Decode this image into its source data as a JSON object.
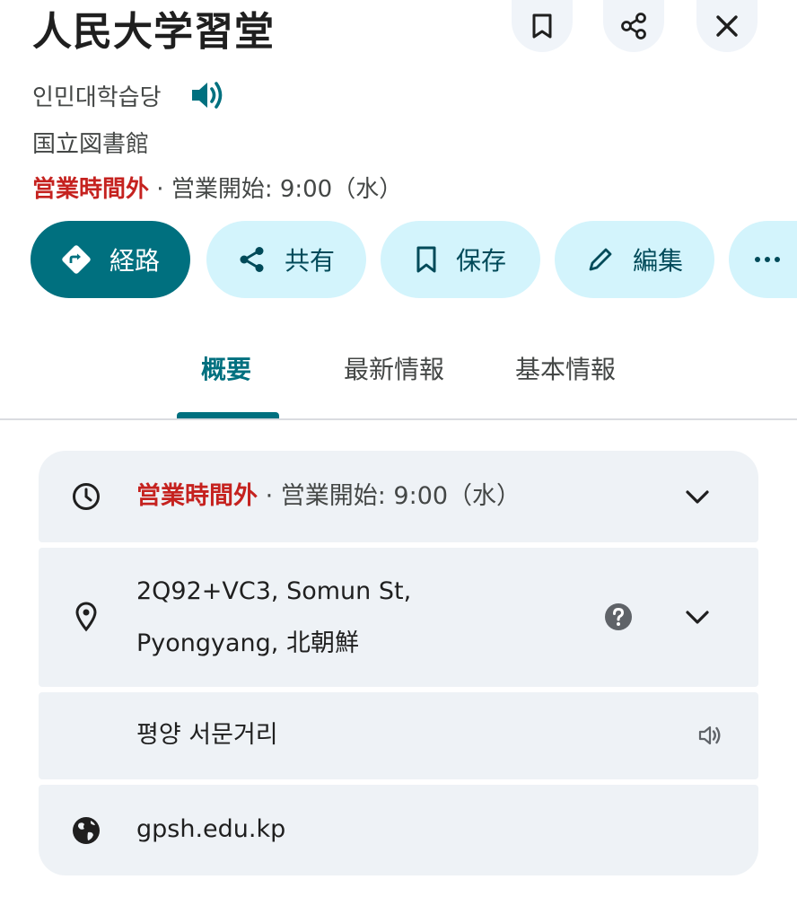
{
  "place": {
    "name": "人民大学習堂",
    "korean_name": "인민대학습당",
    "category": "国立図書館",
    "status_closed": "営業時間外",
    "separator": " · ",
    "opens": "営業開始: 9:00（水）"
  },
  "actions": [
    {
      "label": "経路",
      "icon": "directions-icon"
    },
    {
      "label": "共有",
      "icon": "share-icon"
    },
    {
      "label": "保存",
      "icon": "bookmark-icon"
    },
    {
      "label": "編集",
      "icon": "pencil-icon"
    }
  ],
  "tabs": [
    {
      "label": "概要",
      "active": true
    },
    {
      "label": "最新情報",
      "active": false
    },
    {
      "label": "基本情報",
      "active": false
    }
  ],
  "info": {
    "hours_status": "営業時間外",
    "hours_separator": " · ",
    "hours_opens": "営業開始: 9:00（水）",
    "address_line1": "2Q92+VC3, Somun St,",
    "address_line2": "Pyongyang, 北朝鮮",
    "local_address": "평양 서문거리",
    "website": "gpsh.edu.kp"
  },
  "colors": {
    "accent": "#00707f",
    "chip_bg": "#d3f4fc",
    "closed_red": "#c5221f",
    "card_bg": "#eef2f6"
  }
}
